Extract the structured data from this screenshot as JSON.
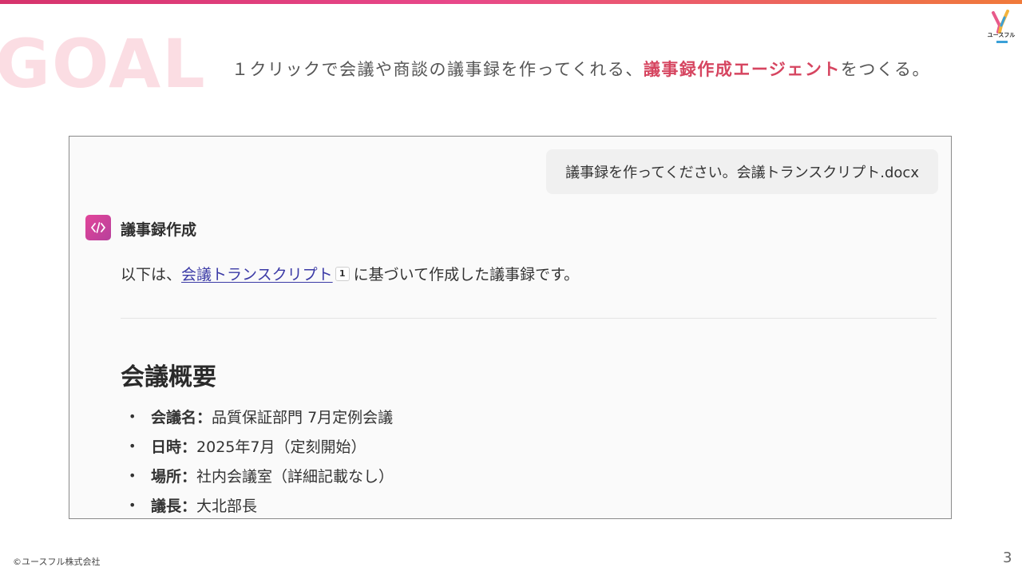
{
  "slide": {
    "watermark": "GOAL",
    "headline_prefix": "１クリックで会議や商談の議事録を作ってくれる、",
    "headline_accent": "議事録作成エージェント",
    "headline_suffix": "をつくる。",
    "logo_text": "ユースフル",
    "copyright": "©ユースフル株式会社",
    "page_number": "3"
  },
  "chat": {
    "user_message": "議事録を作ってください。会議トランスクリプト.docx",
    "agent_name": "議事録作成",
    "intro_prefix": "以下は、",
    "intro_link": "会議トランスクリプト",
    "citation": "1",
    "intro_suffix": "に基づいて作成した議事録です。",
    "section_title": "会議概要",
    "details": [
      {
        "key": "会議名",
        "sep": "：",
        "value": "品質保証部門 7月定例会議"
      },
      {
        "key": "日時",
        "sep": "：",
        "value": "2025年7月（定刻開始）"
      },
      {
        "key": "場所",
        "sep": "：",
        "value": "社内会議室（詳細記載なし）"
      },
      {
        "key": "議長",
        "sep": "：",
        "value": "大北部長"
      }
    ]
  },
  "colors": {
    "accent": "#d64560",
    "link": "#3b3aa6",
    "watermark": "#fbdde3",
    "agent_icon": "#e2459a"
  },
  "icons": {
    "agent": "code-brackets-icon",
    "logo": "usefull-logo-icon",
    "bullet": "bullet-dot"
  }
}
